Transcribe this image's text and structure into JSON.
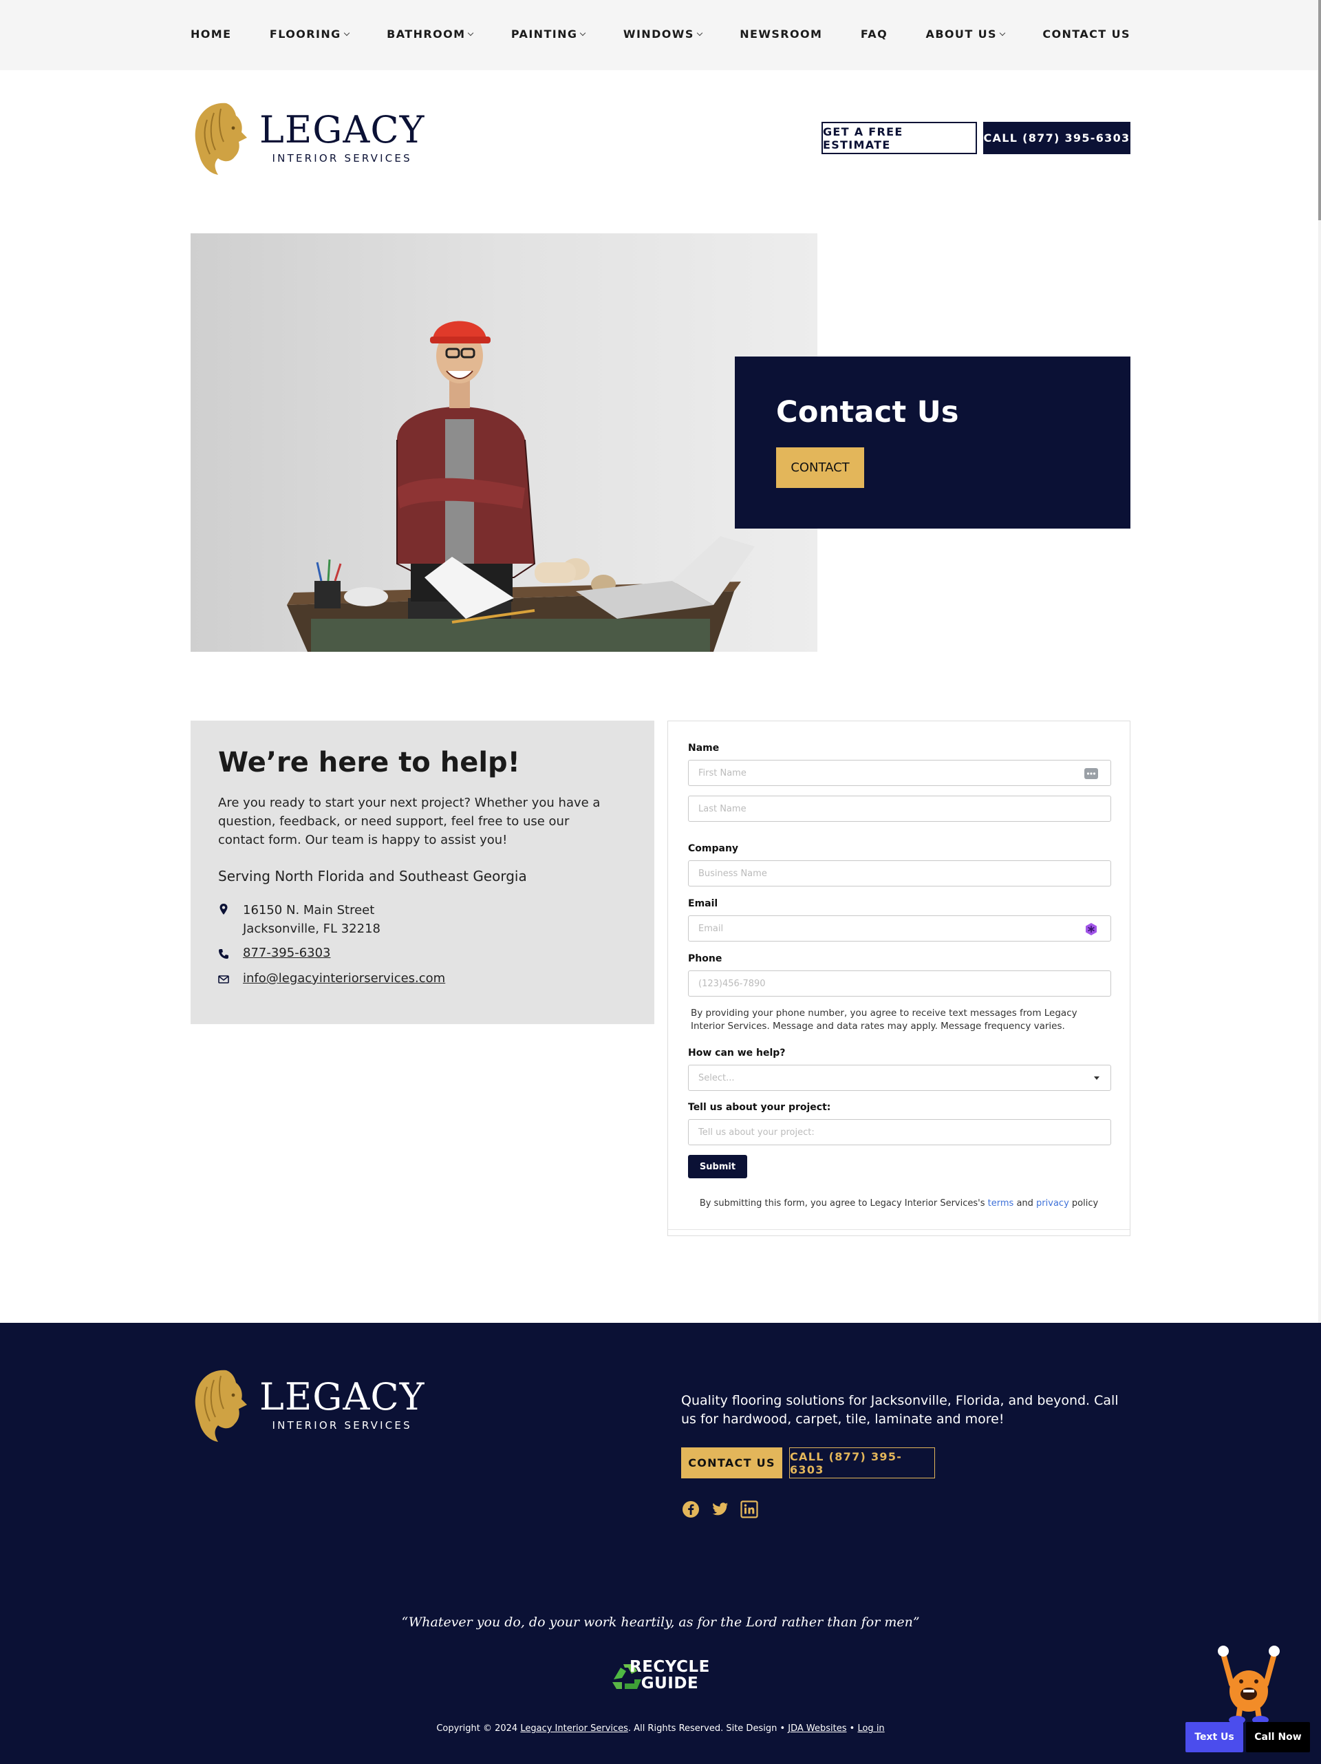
{
  "nav": {
    "items": [
      {
        "label": "HOME",
        "dropdown": false
      },
      {
        "label": "FLOORING",
        "dropdown": true
      },
      {
        "label": "BATHROOM",
        "dropdown": true
      },
      {
        "label": "PAINTING",
        "dropdown": true
      },
      {
        "label": "WINDOWS",
        "dropdown": true
      },
      {
        "label": "NEWSROOM",
        "dropdown": false
      },
      {
        "label": "FAQ",
        "dropdown": false
      },
      {
        "label": "ABOUT US",
        "dropdown": true
      },
      {
        "label": "CONTACT US",
        "dropdown": false
      }
    ]
  },
  "brand": {
    "name": "LEGACY",
    "tagline": "INTERIOR SERVICES",
    "gold": "#e3b65a",
    "navy": "#0b1135"
  },
  "header": {
    "estimate_label": "GET A FREE ESTIMATE",
    "call_label": "CALL (877) 395-6303"
  },
  "hero": {
    "title": "Contact Us",
    "button_label": "CONTACT"
  },
  "help": {
    "heading": "We’re here to help!",
    "intro": "Are you ready to start your next project? Whether you have a question, feedback, or need support, feel free to use our contact form. Our team is happy to assist you!",
    "serving": "Serving North Florida and Southeast Georgia",
    "address_line1": "16150 N. Main Street",
    "address_line2": "Jacksonville, FL 32218",
    "phone": "877-395-6303",
    "email": "info@legacyinteriorservices.com"
  },
  "form": {
    "name_label": "Name",
    "first_placeholder": "First Name",
    "last_placeholder": "Last Name",
    "company_label": "Company",
    "company_placeholder": "Business Name",
    "email_label": "Email",
    "email_placeholder": "Email",
    "phone_label": "Phone",
    "phone_placeholder": "(123)456-7890",
    "sms_note": "By providing your phone number, you agree to receive text messages from Legacy Interior Services. Message and data rates may apply. Message frequency varies.",
    "help_label": "How can we help?",
    "help_placeholder": "Select...",
    "project_label": "Tell us about your project:",
    "project_placeholder": "Tell us about your project:",
    "submit_label": "Submit",
    "terms_prefix": "By submitting this form, you agree to Legacy Interior Services's",
    "terms_link": "terms",
    "terms_and": "and",
    "privacy_link": "privacy",
    "terms_suffix": "policy"
  },
  "footer": {
    "blurb": "Quality flooring solutions for Jacksonville, Florida, and beyond. Call us for hardwood, carpet, tile, laminate and more!",
    "contact_label": "CONTACT US",
    "call_label": "CALL (877) 395-6303",
    "social": [
      "facebook-icon",
      "twitter-icon",
      "linkedin-icon"
    ],
    "quote": "“Whatever you do, do your work heartily, as for the Lord rather than for men”",
    "recycle_line1": "RECYCLE",
    "recycle_line2": "GUIDE",
    "copyright_prefix": "Copyright © 2024",
    "copyright_company": "Legacy Interior Services",
    "copyright_middle": ". All Rights Reserved. Site Design •",
    "copyright_designer": "JDA Websites",
    "copyright_sep": "•",
    "copyright_login": "Log in"
  },
  "chat": {
    "text_label": "Text Us",
    "call_label": "Call Now"
  }
}
